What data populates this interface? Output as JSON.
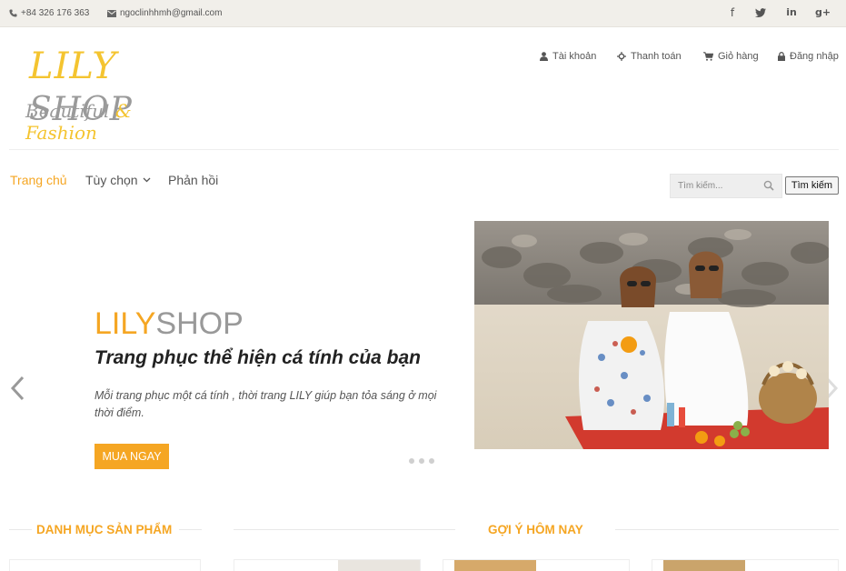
{
  "topbar": {
    "phone": "+84 326 176 363",
    "email": "ngoclinhhmh@gmail.com",
    "social": [
      "facebook-icon",
      "twitter-icon",
      "linkedin-icon",
      "google-plus-icon"
    ]
  },
  "logo": {
    "line1_a": "LILY",
    "line1_b": "SHOP",
    "line2_a": "Beautiful",
    "line2_b": "& Fashion"
  },
  "account": {
    "account_label": "Tài khoản",
    "checkout_label": "Thanh toán",
    "cart_label": "Giỏ hàng",
    "login_label": "Đăng nhập"
  },
  "nav": {
    "home": "Trang chủ",
    "options": "Tùy chọn",
    "feedback": "Phản hồi",
    "search_placeholder": "Tìm kiếm...",
    "search_button": "Tìm kiếm"
  },
  "hero": {
    "brand_a": "LILY",
    "brand_b": "SHOP",
    "title": "Trang phục thể hiện cá tính của bạn",
    "description": "Mỗi trang phục một cá tính , thời trang LILY giúp bạn tỏa sáng ở mọi thời điểm.",
    "cta": "MUA NGAY",
    "slides": 3
  },
  "sections": {
    "categories": "DANH MỤC SẢN PHẨM",
    "suggestions": "GỢI Ý HÔM NAY"
  },
  "colors": {
    "accent": "#f5a623",
    "logo_yellow": "#f4c430",
    "topbar_bg": "#f1efea"
  }
}
